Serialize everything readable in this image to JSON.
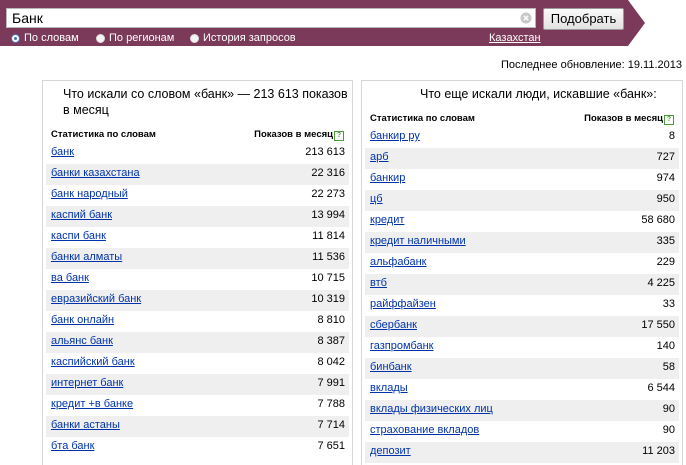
{
  "search": {
    "query": "Банк",
    "submit_label": "Подобрать",
    "modes": [
      {
        "label": "По словам",
        "selected": true
      },
      {
        "label": "По регионам",
        "selected": false
      },
      {
        "label": "История запросов",
        "selected": false
      }
    ],
    "region": "Казахстан"
  },
  "last_update": "Последнее обновление: 19.11.2013",
  "left_panel": {
    "title": "Что искали со словом «банк» — 213 613 показов в месяц",
    "col_keyword": "Статистика по словам",
    "col_count": "Показов в месяц",
    "rows": [
      {
        "keyword": "банк",
        "count": "213 613"
      },
      {
        "keyword": "банки казахстана",
        "count": "22 316"
      },
      {
        "keyword": "банк народный",
        "count": "22 273"
      },
      {
        "keyword": "каспий банк",
        "count": "13 994"
      },
      {
        "keyword": "каспи банк",
        "count": "11 814"
      },
      {
        "keyword": "банки алматы",
        "count": "11 536"
      },
      {
        "keyword": "ва банк",
        "count": "10 715"
      },
      {
        "keyword": "евразийский банк",
        "count": "10 319"
      },
      {
        "keyword": "банк онлайн",
        "count": "8 810"
      },
      {
        "keyword": "альянс банк",
        "count": "8 387"
      },
      {
        "keyword": "каспийский банк",
        "count": "8 042"
      },
      {
        "keyword": "интернет банк",
        "count": "7 991"
      },
      {
        "keyword": "кредит +в банке",
        "count": "7 788"
      },
      {
        "keyword": "банки астаны",
        "count": "7 714"
      },
      {
        "keyword": "бта банк",
        "count": "7 651"
      }
    ]
  },
  "right_panel": {
    "title": "Что еще искали люди, искавшие «банк»:",
    "col_keyword": "Статистика по словам",
    "col_count": "Показов в месяц",
    "rows": [
      {
        "keyword": "банкир ру",
        "count": "8"
      },
      {
        "keyword": "арб",
        "count": "727"
      },
      {
        "keyword": "банкир",
        "count": "974"
      },
      {
        "keyword": "цб",
        "count": "950"
      },
      {
        "keyword": "кредит",
        "count": "58 680"
      },
      {
        "keyword": "кредит наличными",
        "count": "335"
      },
      {
        "keyword": "альфабанк",
        "count": "229"
      },
      {
        "keyword": "втб",
        "count": "4 225"
      },
      {
        "keyword": "райффайзен",
        "count": "33"
      },
      {
        "keyword": "сбербанк",
        "count": "17 550"
      },
      {
        "keyword": "газпромбанк",
        "count": "140"
      },
      {
        "keyword": "бинбанк",
        "count": "58"
      },
      {
        "keyword": "вклады",
        "count": "6 544"
      },
      {
        "keyword": "вклады физических лиц",
        "count": "90"
      },
      {
        "keyword": "страхование вкладов",
        "count": "90"
      },
      {
        "keyword": "депозит",
        "count": "11 203"
      }
    ]
  },
  "colors": {
    "topbar": "#7b3a5a",
    "link": "#0033aa",
    "row_alt": "#efefef",
    "help": "#4a9a3a"
  }
}
